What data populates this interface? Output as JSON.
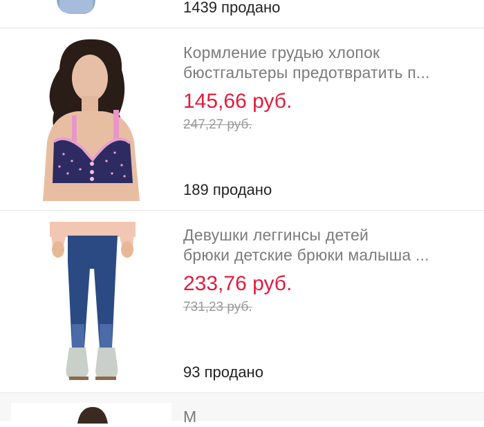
{
  "products": [
    {
      "sold": "1439 продано"
    },
    {
      "title_line1": "Кормление грудью хлопок",
      "title_line2": "бюстгальтеры предотвратить п...",
      "price": "145,66 руб.",
      "old_price": "247,27 руб.",
      "sold": "189 продано",
      "image_icon": "nursing-bra-photo"
    },
    {
      "title_line1": "Девушки леггинсы детей",
      "title_line2": "брюки детские брюки малыша ...",
      "price": "233,76 руб.",
      "old_price": "731,23 руб.",
      "sold": "93 продано",
      "image_icon": "kids-leggings-photo"
    },
    {
      "title_line1": "М",
      "image_icon": "product-photo"
    }
  ],
  "colors": {
    "price": "#e31b3c",
    "title": "#7b7b7b",
    "old_price": "#999999",
    "sold": "#222222",
    "divider": "#e4e4e4"
  }
}
